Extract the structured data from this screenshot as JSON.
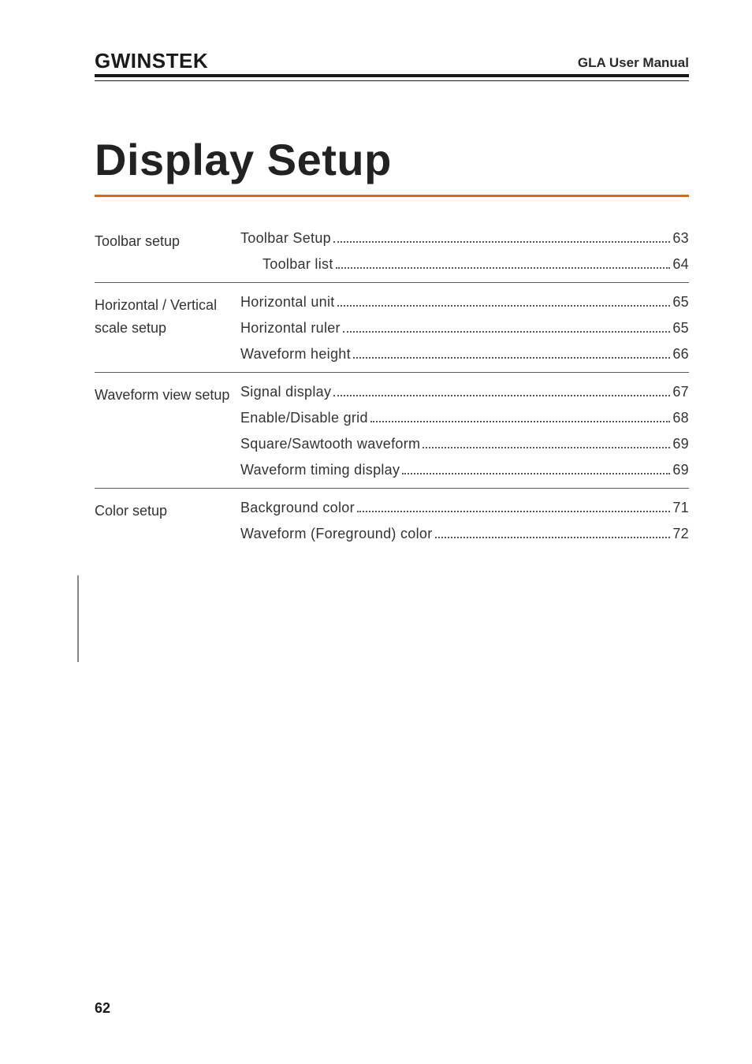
{
  "header": {
    "logo_text": "GWINSTEK",
    "doc_title": "GLA User Manual"
  },
  "chapter_title": "Display Setup",
  "toc": [
    {
      "label": "Toolbar setup",
      "entries": [
        {
          "text": "Toolbar Setup",
          "page": "63",
          "indent": false
        },
        {
          "text": "Toolbar list",
          "page": "64",
          "indent": true
        }
      ]
    },
    {
      "label": "Horizontal / Vertical scale setup",
      "entries": [
        {
          "text": "Horizontal unit",
          "page": "65",
          "indent": false
        },
        {
          "text": "Horizontal ruler",
          "page": "65",
          "indent": false
        },
        {
          "text": "Waveform height",
          "page": "66",
          "indent": false
        }
      ]
    },
    {
      "label": "Waveform view setup",
      "entries": [
        {
          "text": "Signal display",
          "page": "67",
          "indent": false
        },
        {
          "text": "Enable/Disable grid",
          "page": "68",
          "indent": false
        },
        {
          "text": "Square/Sawtooth waveform",
          "page": "69",
          "indent": false
        },
        {
          "text": "Waveform timing display",
          "page": "69",
          "indent": false
        }
      ]
    },
    {
      "label": "Color setup",
      "entries": [
        {
          "text": "Background color",
          "page": "71",
          "indent": false
        },
        {
          "text": "Waveform (Foreground) color",
          "page": "72",
          "indent": false
        }
      ]
    }
  ],
  "page_number": "62"
}
